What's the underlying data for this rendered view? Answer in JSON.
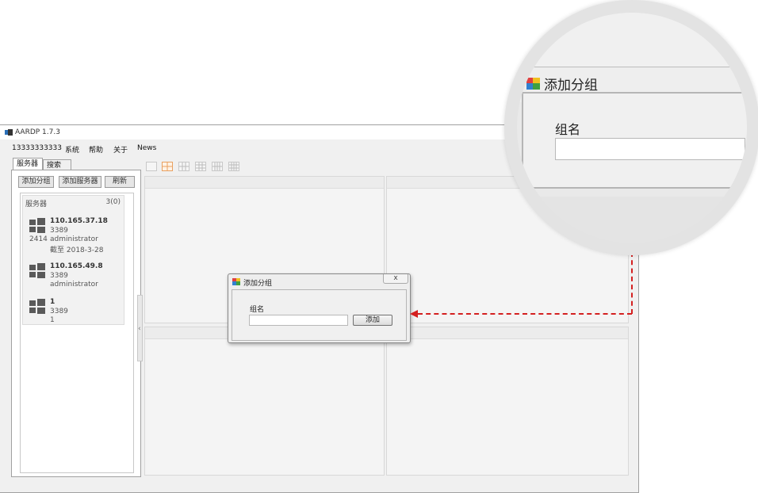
{
  "window": {
    "title": "AARDP 1.7.3"
  },
  "menu": [
    "13333333333",
    "系统",
    "帮助",
    "关于",
    "News"
  ],
  "tabs": [
    "服务器",
    "搜索"
  ],
  "panel_buttons": [
    "添加分组",
    "添加服务器",
    "刷新"
  ],
  "server_group": {
    "name": "服务器",
    "count": "3(0)",
    "servers": [
      {
        "ip": "110.165.37.18",
        "port": "3389",
        "user": "administrator",
        "expires": "截至 2018-3-28",
        "number": "2414"
      },
      {
        "ip": "110.165.49.8",
        "port": "3389",
        "user": "administrator"
      },
      {
        "ip": "1",
        "port": "3389",
        "user": "1"
      }
    ]
  },
  "dialog": {
    "title": "添加分组",
    "close_glyph": "x",
    "field_label": "组名",
    "input_value": "",
    "add_button": "添加"
  },
  "magnifier": {
    "title": "添加分组",
    "field_label": "组名"
  },
  "splitter_glyph": "‹",
  "colors": {
    "accent_connector": "#d42020",
    "active_layout": "#e8a060"
  }
}
